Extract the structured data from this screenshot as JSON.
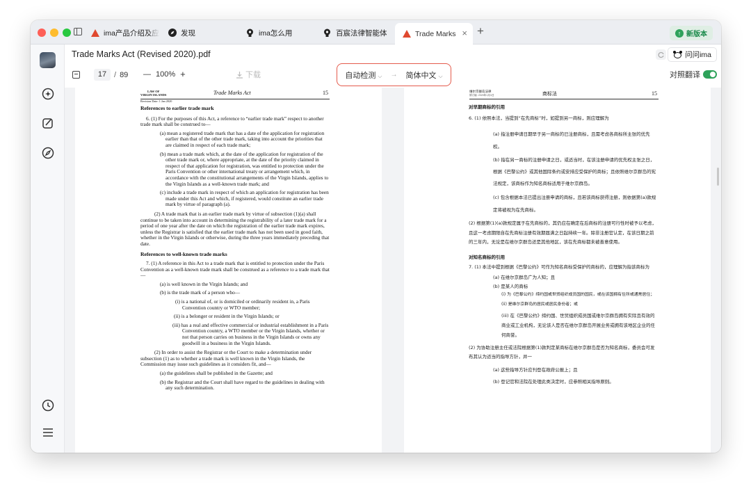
{
  "tabs": [
    {
      "label": "ima产品介绍及应用",
      "icon": "ima-logo-icon",
      "active": false
    },
    {
      "label": "发现",
      "icon": "discover-icon",
      "active": false
    },
    {
      "label": "ima怎么用",
      "icon": "lightbulb-icon",
      "active": false
    },
    {
      "label": "百宸法律智能体",
      "icon": "lightbulb-icon",
      "active": false
    },
    {
      "label": "Trade Marks",
      "icon": "ima-logo-icon",
      "active": true
    }
  ],
  "new_version_label": "新版本",
  "doc_title": "Trade Marks Act (Revised 2020).pdf",
  "ask_ima_label": "问问ima",
  "toolbar": {
    "page_current": "17",
    "page_sep": "/",
    "page_total": "89",
    "zoom_minus": "—",
    "zoom": "100%",
    "zoom_plus": "+",
    "download": "下载"
  },
  "lang": {
    "source": "自动检测",
    "arrow": "→",
    "target": "简体中文"
  },
  "compare_label": "对照翻译",
  "compare_on": true,
  "colors": {
    "accent_red": "#e45a4b",
    "toggle_green": "#2ea25a",
    "title_red": "#e0492f"
  },
  "left_page": {
    "hdr_law": "LAW OF",
    "hdr_islands": "VIRGIN ISLANDS",
    "hdr_title": "Trade Marks Act",
    "hdr_num": "15",
    "hdr_rev": "Revision Date: 1 Jan 2020",
    "h1": "References to earlier trade mark",
    "p6": "6. (1) For the purposes of this Act, a reference to “earlier trade mark” respect to another trade mark shall be construed to—",
    "a": "(a) mean a registered trade mark that has a date of the application for registration earlier than that of the other trade mark, taking into account the priorities that are claimed in respect of each trade mark;",
    "b": "(b) mean a trade mark which, at the date of the application for registration of the other trade mark or, where appropriate, at the date of the priority claimed in respect of that application for registration, was entitled to protection under the Paris Convention or other international treaty or arrangement which, in accordance with the constitutional arrangements of the Virgin Islands, applies to the Virgin Islands as a well-known trade mark; and",
    "c": "(c) include a trade mark in respect of which an application for registration has been made under this Act and which, if registered, would constitute an earlier trade mark by virtue of paragraph (a).",
    "p2": "(2) A trade mark that is an earlier trade mark by virtue of subsection (1)(a) shall continue to be taken into account in determining the registrability of a later trade mark for a period of one year after the date on which the registration of the earlier trade mark expires, unless the Registrar is satisfied that the earlier trade mark has not been used in good faith, whether in the Virgin Islands or otherwise, during the three years immediately preceding that date.",
    "h2": "References to well-known trade marks",
    "p7": "7. (1) A reference in this Act to a trade mark that is entitled to protection under the Paris Convention as a well-known trade mark shall be construed as a reference to a trade mark that—",
    "a7": "(a) is well known in the Virgin Islands; and",
    "b7": "(b) is the trade mark of a person who—",
    "i": "(i) is a national of, or is domiciled or ordinarily resident in, a Paris Convention country or WTO member;",
    "ii": "(ii) is a belonger or resident in the Virgin Islands; or",
    "iii": "(iii) has a real and effective commercial or industrial establishment in a Paris Convention country, a WTO member or the Virgin Islands, whether or not that person carries on business in the Virgin Islands or owns any goodwill in a business in the Virgin Islands.",
    "p72": "(2) In order to assist the Registrar or the Court to make a determination under subsection (1) as to whether a trade mark is well known in the Virgin Islands, the Commission may issue such guidelines as it considers fit, and—",
    "a72": "(a) the guidelines shall be published in the Gazette; and",
    "b72": "(b) the Registrar and the Court shall have regard to the guidelines in dealing with any such determination."
  },
  "right_page": {
    "hdr_law": "维尔京群岛法律",
    "hdr_rev": "修订版: 2020年1月1日",
    "hdr_title": "商标法",
    "hdr_num": "15",
    "h1": "对早期商标的引用",
    "p6": "6. (1) 依照本法，当提到“在先商标”时，如提到另一商标，则应理解为",
    "a": "(a) 指注册申请日期早于另一商标的已注册商标，且需考虑各商标所主张的优先权。",
    "b": "(b) 指在另一商标的注册申请之日，或适当时，在该注册申请的优先权主张之日，根据《巴黎公约》或其他国际条约或安排应受保护的商标；且依照维尔京群岛的宪法规定，该商标作为知名商标适用于维尔京群岛。",
    "c": "(c) 包含根据本法已提出注册申请的商标，且若该商标获得注册，则依据第(a)款规定将被视为在先商标。",
    "p2": "(2) 根据第(1)(a)款规定属于在先商标的，其仍应在确定在后商标的注册可行性时被予以考虑，且这一考虑期限自在先商标注册有效期届满之日起持续一年。除非注册官认定，在该日期之前的三年内，无论是在维尔京群岛还是其他地区，该在先商标都未被善意使用。",
    "h2": "对知名商标的引用",
    "p7": "7. (1) 本法中提到根据《巴黎公约》可作为知名商标受保护的商标的，应理解为指该商标为",
    "a7": "(a) 在维尔京群岛广为人知；且",
    "b7": "(b) 是某人的商标",
    "i": "(i) 为《巴黎公约》缔约国或世贸组织成员国的国民，或在该国拥有住所或通常居住；",
    "ii": "(ii) 是维尔京群岛的居民或居民身份者；或",
    "iii": "(iii) 在《巴黎公约》缔约国、世贸组织成员国或维尔京群岛拥有实际且有效的商业或工业机构，无论该人是否在维尔京群岛开展业务或拥有该地区企业的任何商誉。",
    "p72": "(2) 为协助注册主任或法院根据第(1)款判定某商标在维尔京群岛是否为知名商标，委员会可发布其认为适当的指导方针，并一",
    "a72": "(a) 这些指导方针应刊登在政府公报上；且",
    "b72": "(b) 登记官和法院在处理此类决定时，应参照相关指导原则。"
  }
}
